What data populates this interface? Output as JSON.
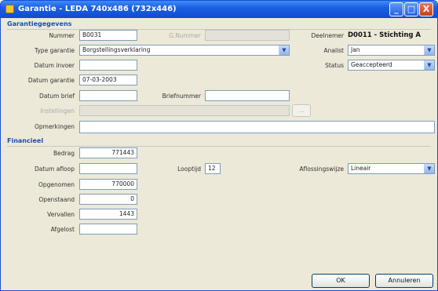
{
  "window": {
    "title": "Garantie - LEDA 740x486 (732x446)",
    "minimize": "_",
    "maximize": "□",
    "close": "X"
  },
  "garantie": {
    "section_title": "Garantiegegevens",
    "nummer_label": "Nummer",
    "nummer_value": "B0031",
    "gnummer_label": "G.Nummer",
    "deelnemer_label": "Deelnemer",
    "deelnemer_value": "D0011 - Stichting A",
    "type_label": "Type garantie",
    "type_value": "Borgstellingsverklaring",
    "analist_label": "Analist",
    "analist_value": "Jan",
    "datum_invoer_label": "Datum invoer",
    "status_label": "Status",
    "status_value": "Geaccepteerd",
    "datum_garantie_label": "Datum garantie",
    "datum_garantie_value": "07-03-2003",
    "datum_brief_label": "Datum brief",
    "briefnummer_label": "Briefnummer",
    "instellingen_label": "Instellingen",
    "browse_label": "...",
    "opmerkingen_label": "Opmerkingen"
  },
  "financieel": {
    "section_title": "Financieel",
    "bedrag_label": "Bedrag",
    "bedrag_value": "771443",
    "datum_afloop_label": "Datum afloop",
    "looptijd_label": "Looptijd",
    "looptijd_value": "12",
    "aflossingswijze_label": "Aflossingswijze",
    "aflossingswijze_value": "Lineair",
    "opgenomen_label": "Opgenomen",
    "opgenomen_value": "770000",
    "openstaand_label": "Openstaand",
    "openstaand_value": "0",
    "vervallen_label": "Vervallen",
    "vervallen_value": "1443",
    "afgelost_label": "Afgelost"
  },
  "buttons": {
    "ok": "OK",
    "cancel": "Annuleren"
  }
}
